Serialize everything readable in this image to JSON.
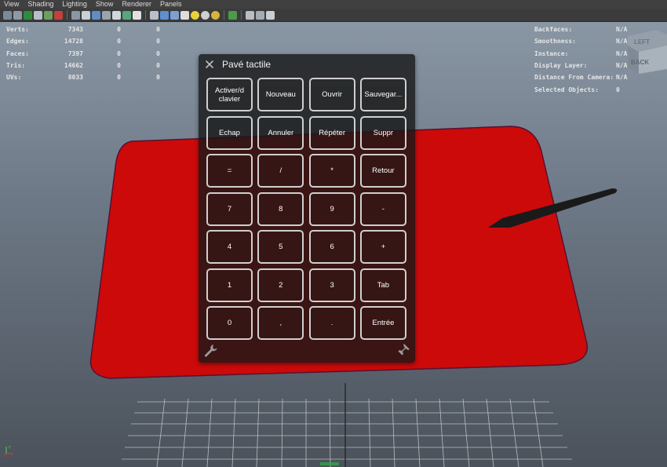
{
  "menu": [
    "View",
    "Shading",
    "Lighting",
    "Show",
    "Renderer",
    "Panels"
  ],
  "hud_left": [
    {
      "label": "Verts:",
      "v1": "7343",
      "v2": "0",
      "v3": "0"
    },
    {
      "label": "Edges:",
      "v1": "14728",
      "v2": "0",
      "v3": "0"
    },
    {
      "label": "Faces:",
      "v1": "7397",
      "v2": "0",
      "v3": "0"
    },
    {
      "label": "Tris:",
      "v1": "14662",
      "v2": "0",
      "v3": "0"
    },
    {
      "label": "UVs:",
      "v1": "8033",
      "v2": "0",
      "v3": "0"
    }
  ],
  "hud_right": [
    {
      "label": "Backfaces:",
      "value": "N/A"
    },
    {
      "label": "Smoothness:",
      "value": "N/A"
    },
    {
      "label": "Instance:",
      "value": "N/A"
    },
    {
      "label": "Display Layer:",
      "value": "N/A"
    },
    {
      "label": "Distance From Camera:",
      "value": "N/A"
    },
    {
      "label": "Selected Objects:",
      "value": "0"
    }
  ],
  "viewcube": {
    "top_label": "LEFT",
    "front_label": "BACK"
  },
  "panel": {
    "title": "Pavé tactile",
    "keys": [
      "Activer/d\nclavier",
      "Nouveau",
      "Ouvrir",
      "Sauvegar...",
      "Echap",
      "Annuler",
      "Répéter",
      "Suppr",
      "=",
      "/",
      "*",
      "Retour",
      "7",
      "8",
      "9",
      "-",
      "4",
      "5",
      "6",
      "+",
      "1",
      "2",
      "3",
      "Tab",
      "0",
      ",",
      ".",
      "Entrée"
    ]
  },
  "axis": {
    "x": "X",
    "y": "Y"
  },
  "colors": {
    "mat": "#cc0a0a",
    "panel_bg": "#161616",
    "key_border": "#cfcfcf",
    "grid": "#c8c8c8"
  }
}
